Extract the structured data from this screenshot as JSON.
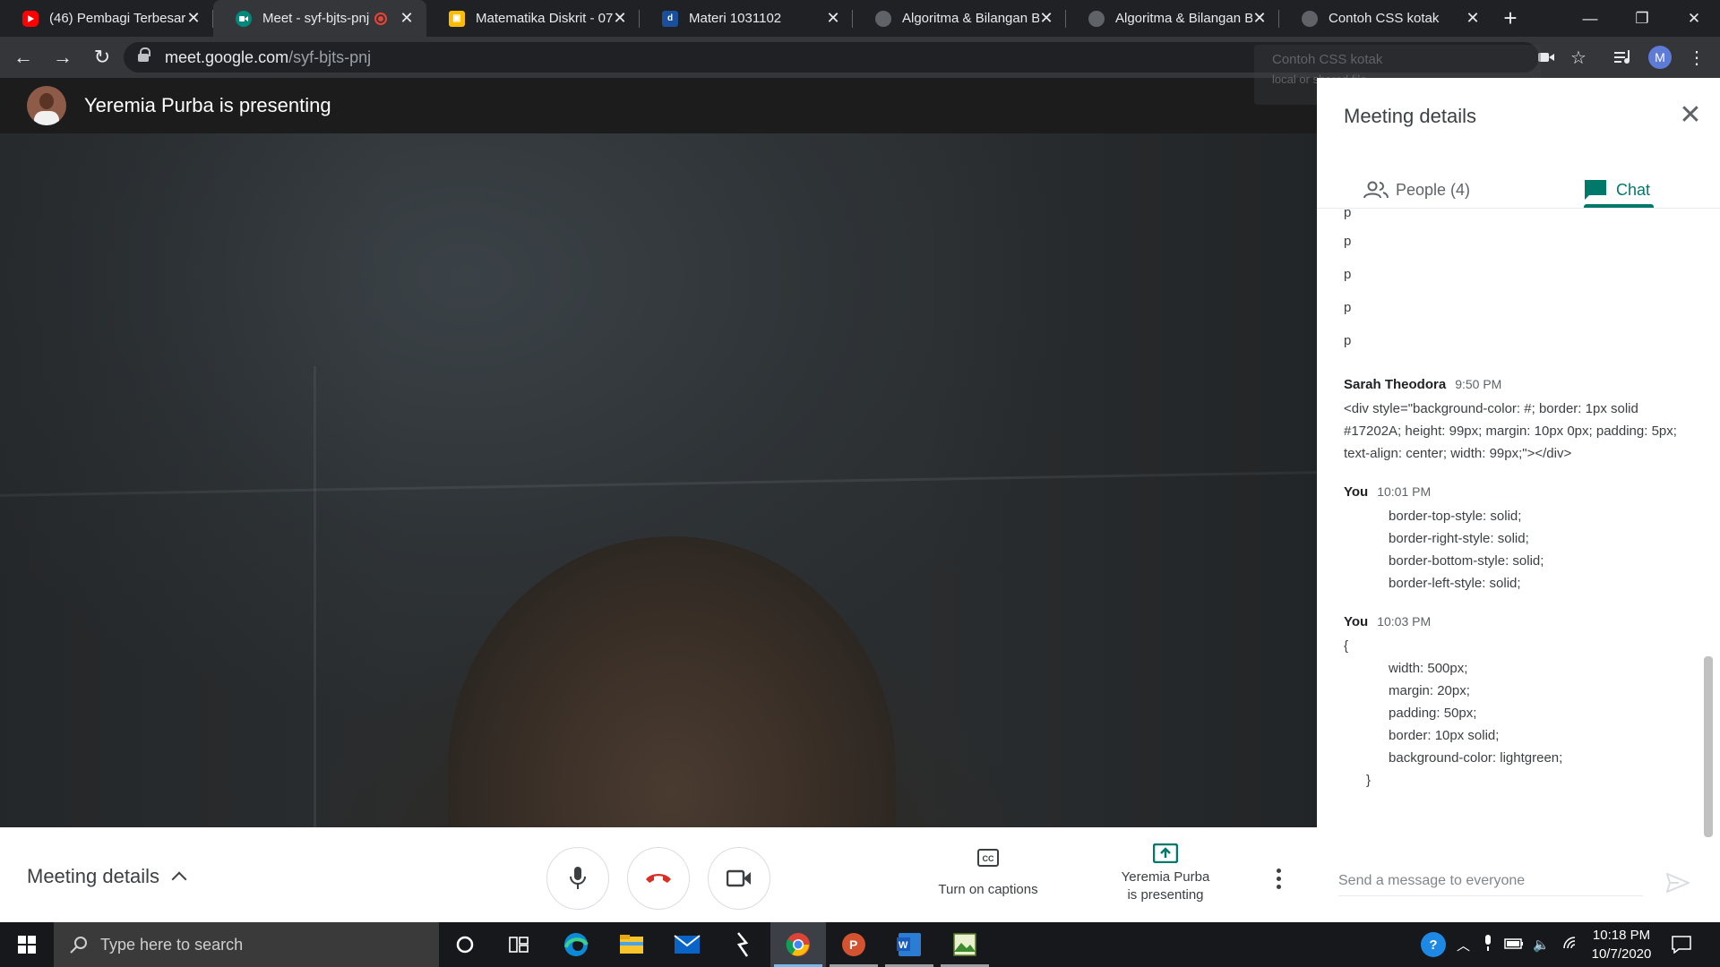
{
  "browser": {
    "tabs": [
      {
        "title": "(46) Pembagi Terbesar",
        "favicon": "youtube-icon",
        "active": false
      },
      {
        "title": "Meet - syf-bjts-pnj",
        "favicon": "meet-icon",
        "active": true,
        "recording": true
      },
      {
        "title": "Matematika Diskrit - 07",
        "favicon": "slides-icon",
        "active": false
      },
      {
        "title": "Materi 1031102",
        "favicon": "del-icon",
        "active": false
      },
      {
        "title": "Algoritma & Bilangan B",
        "favicon": "globe-icon",
        "active": false
      },
      {
        "title": "Algoritma & Bilangan B",
        "favicon": "globe-icon",
        "active": false
      },
      {
        "title": "Contoh CSS kotak",
        "favicon": "globe-icon",
        "active": false
      }
    ],
    "url_host": "meet.google.com",
    "url_path": "/syf-bjts-pnj",
    "profile_initial": "M",
    "tooltip_title": "Contoh CSS kotak",
    "tooltip_sub": "local or shared file"
  },
  "meet": {
    "presenter_title": "Yeremia Purba is presenting",
    "bottom": {
      "meeting_details_label": "Meeting details",
      "captions_label": "Turn on captions",
      "presenting_line1": "Yeremia Purba",
      "presenting_line2": "is presenting"
    },
    "panel": {
      "title": "Meeting details",
      "people_tab": "People (4)",
      "chat_tab": "Chat",
      "composer_placeholder": "Send a message to everyone",
      "messages": [
        {
          "sender": "Sarah Theodora",
          "time": "9:50 PM",
          "body": "<div style=\"background-color: #; border: 1px solid #17202A; height: 99px; margin: 10px 0px; padding: 5px; text-align: center; width: 99px;\"></div>"
        },
        {
          "sender": "You",
          "time": "10:01 PM",
          "body": "            border-top-style: solid;\n            border-right-style: solid;\n            border-bottom-style: solid;\n            border-left-style: solid;"
        },
        {
          "sender": "You",
          "time": "10:03 PM",
          "body": "{\n            width: 500px;\n            margin: 20px;\n            padding: 50px;\n            border: 10px solid;\n            background-color: lightgreen;\n      }"
        }
      ],
      "p_lines": [
        "p",
        "p",
        "p",
        "p"
      ]
    }
  },
  "taskbar": {
    "search_placeholder": "Type here to search",
    "time": "10:18 PM",
    "date": "10/7/2020"
  },
  "colors": {
    "accent_teal": "#00796b",
    "hangup_red": "#d93025",
    "chrome_dark": "#202124"
  }
}
